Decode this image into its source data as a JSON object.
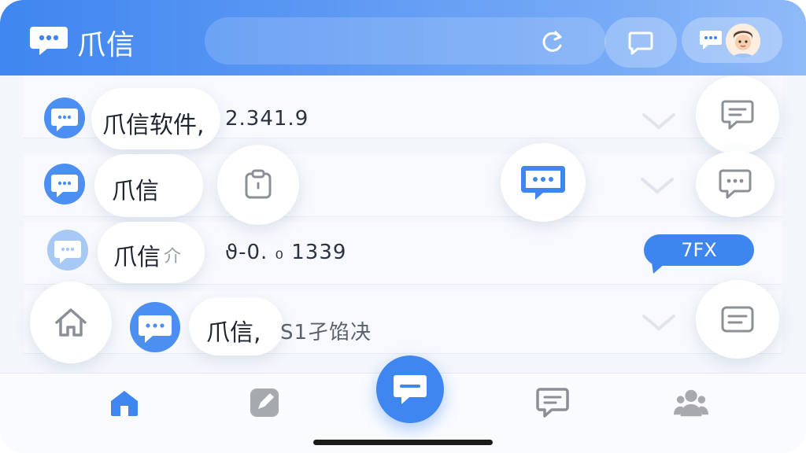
{
  "app": {
    "title": "爪信"
  },
  "rows": [
    {
      "title": "爪信软件,",
      "subtitle": "2.341.9"
    },
    {
      "title": "爪信",
      "subtitle": ""
    },
    {
      "title": "爪信",
      "title_suffix": "介",
      "subtitle": "ϑ-0. ₀ 1339",
      "tag": "7FX"
    },
    {
      "title": "爪信,",
      "subtitle": "S1孑馅决"
    }
  ],
  "colors": {
    "accent": "#3f86f0",
    "header_end": "#8fbaf8",
    "icon_gray": "#8c8f96"
  },
  "icons": {
    "header": [
      "refresh-icon",
      "chat-icon",
      "chat-bubble-icon",
      "avatar"
    ],
    "tabs": [
      "home-icon",
      "edit-icon",
      "compose-icon",
      "messages-icon",
      "contacts-icon"
    ]
  }
}
